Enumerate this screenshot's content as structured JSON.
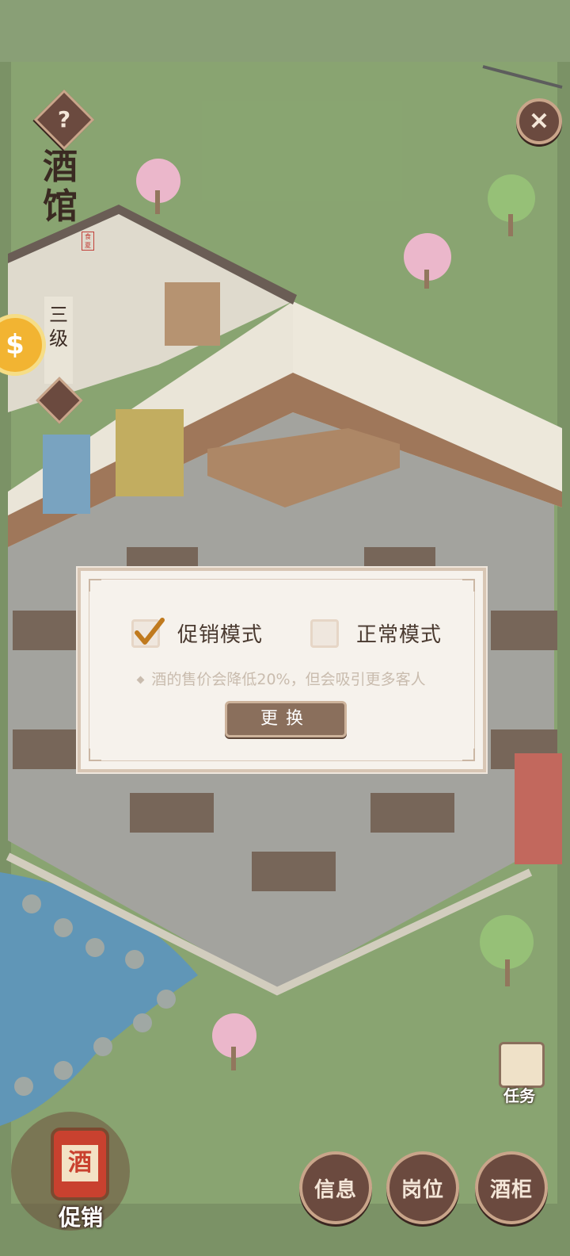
{
  "header": {
    "help_icon": "question-icon",
    "close_icon": "close-icon",
    "title": "酒馆",
    "seal_text": "食夏",
    "level": "三级",
    "hammer_icon": "hammer-icon",
    "coin_icon": "coin-icon"
  },
  "dialog": {
    "option_promo": {
      "label": "促销模式",
      "checked": true
    },
    "option_normal": {
      "label": "正常模式",
      "checked": false
    },
    "description": "酒的售价会降低20%，但会吸引更多客人",
    "change_button": "更换"
  },
  "side": {
    "task_label": "任务",
    "task_icon": "scroll-icon"
  },
  "bottom_bar": {
    "promo_label": "促销",
    "promo_jar_text": "酒",
    "info_label": "信息",
    "post_label": "岗位",
    "cabinet_label": "酒柜"
  },
  "colors": {
    "grass": "#5e7a45",
    "floor": "#9a9993",
    "button_brown": "#6b4a3f",
    "button_border": "#c9a58a",
    "dialog_bg": "#f6f2ec"
  }
}
